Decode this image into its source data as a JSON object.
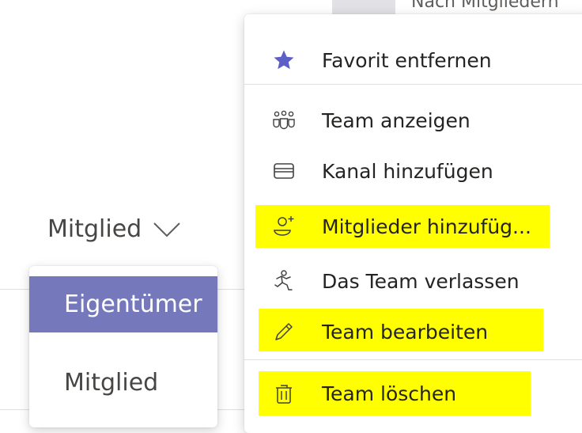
{
  "background": {
    "top_right_text": "Nach Mitgliedern",
    "role_trigger_label": "Mitglied"
  },
  "role_menu": {
    "options": [
      {
        "label": "Eigentümer",
        "selected": true
      },
      {
        "label": "Mitglied",
        "selected": false
      }
    ]
  },
  "context_menu": {
    "items": [
      {
        "label": "Favorit entfernen",
        "icon": "star-icon"
      },
      {
        "label": "Team anzeigen",
        "icon": "people-icon"
      },
      {
        "label": "Kanal hinzufügen",
        "icon": "channel-icon"
      },
      {
        "label": "Mitglieder hinzufüg...",
        "icon": "add-person-icon",
        "highlighted": true
      },
      {
        "label": "Das Team verlassen",
        "icon": "leave-icon"
      },
      {
        "label": "Team bearbeiten",
        "icon": "pencil-icon",
        "highlighted": true
      },
      {
        "label": "Team löschen",
        "icon": "trash-icon",
        "highlighted": true
      }
    ]
  },
  "colors": {
    "accent": "#6264a7",
    "selected_bg": "#7579bc",
    "highlight": "#ffff00",
    "text": "#252423"
  }
}
